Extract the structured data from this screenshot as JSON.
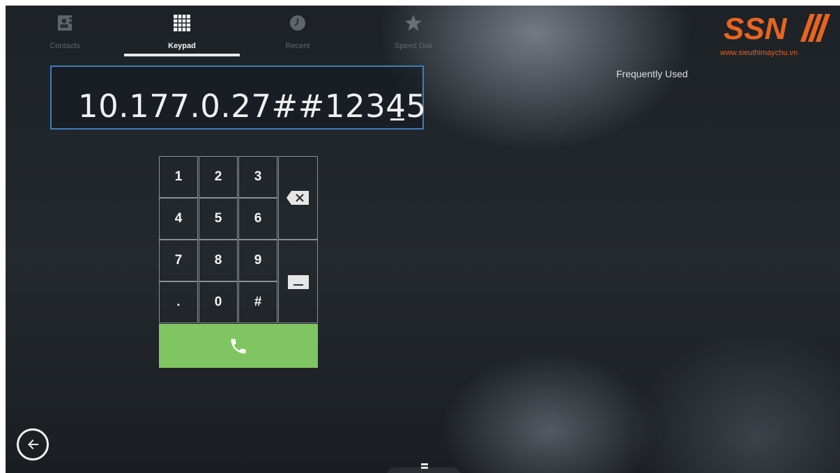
{
  "tabs": [
    {
      "label": "Contacts",
      "icon": "contacts-icon",
      "active": false
    },
    {
      "label": "Keypad",
      "icon": "keypad-icon",
      "active": true
    },
    {
      "label": "Recent",
      "icon": "clock-icon",
      "active": false
    },
    {
      "label": "Speed Dial",
      "icon": "star-icon",
      "active": false
    }
  ],
  "dial": {
    "value": "10.177.0.27##12345"
  },
  "keypad": {
    "keys": [
      "1",
      "2",
      "3",
      "4",
      "5",
      "6",
      "7",
      "8",
      "9",
      ".",
      "0",
      "#"
    ],
    "backspace_icon": "backspace-icon",
    "space_icon": "space-icon",
    "call_icon": "phone-icon"
  },
  "frequently_used": {
    "title": "Frequently Used"
  },
  "branding": {
    "logo_text": "SSN",
    "url": "www.sieuthimaychu.vn",
    "color": "#e8641f"
  },
  "colors": {
    "accent_border": "#3d7fbf",
    "call_green": "#7fc562"
  }
}
